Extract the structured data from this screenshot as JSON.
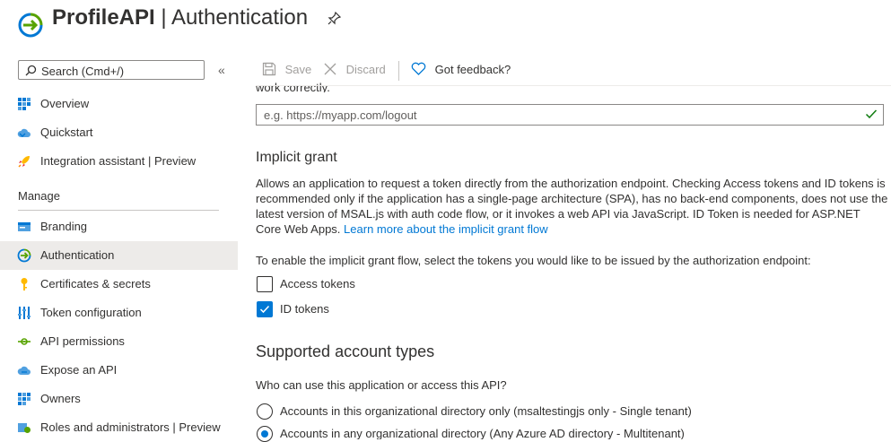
{
  "header": {
    "app_name": "ProfileAPI",
    "separator": " | ",
    "page": "Authentication"
  },
  "sidebar": {
    "search_placeholder": "Search (Cmd+/)",
    "collapse_glyph": "«",
    "top_items": [
      {
        "label": "Overview",
        "icon": "grid-icon"
      },
      {
        "label": "Quickstart",
        "icon": "cloud-icon"
      },
      {
        "label": "Integration assistant | Preview",
        "icon": "rocket-icon"
      }
    ],
    "section": "Manage",
    "manage_items": [
      {
        "label": "Branding",
        "icon": "card-icon"
      },
      {
        "label": "Authentication",
        "icon": "auth-arrow-icon",
        "active": true
      },
      {
        "label": "Certificates & secrets",
        "icon": "key-icon"
      },
      {
        "label": "Token configuration",
        "icon": "sliders-icon"
      },
      {
        "label": "API permissions",
        "icon": "api-icon"
      },
      {
        "label": "Expose an API",
        "icon": "cloud-icon"
      },
      {
        "label": "Owners",
        "icon": "grid-icon"
      },
      {
        "label": "Roles and administrators | Preview",
        "icon": "roles-icon"
      }
    ]
  },
  "toolbar": {
    "save": "Save",
    "discard": "Discard",
    "feedback": "Got feedback?"
  },
  "main": {
    "cut_text": "work correctly.",
    "logout_placeholder": "e.g. https://myapp.com/logout",
    "implicit": {
      "title": "Implicit grant",
      "description": "Allows an application to request a token directly from the authorization endpoint. Checking Access tokens and ID tokens is recommended only if the application has a single-page architecture (SPA), has no back-end components, does not use the latest version of MSAL.js with auth code flow, or it invokes a web API via JavaScript. ID Token is needed for ASP.NET Core Web Apps.",
      "link": "Learn more about the implicit grant flow",
      "prompt": "To enable the implicit grant flow, select the tokens you would like to be issued by the authorization endpoint:",
      "access_tokens": "Access tokens",
      "access_checked": false,
      "id_tokens": "ID tokens",
      "id_checked": true
    },
    "accounts": {
      "title": "Supported account types",
      "question": "Who can use this application or access this API?",
      "option1": "Accounts in this organizational directory only (msaltestingjs only - Single tenant)",
      "option2": "Accounts in any organizational directory (Any Azure AD directory - Multitenant)",
      "selected": 2
    }
  },
  "colors": {
    "accent": "#0078d4",
    "success": "#107c10",
    "active_bg": "#edebe9"
  }
}
